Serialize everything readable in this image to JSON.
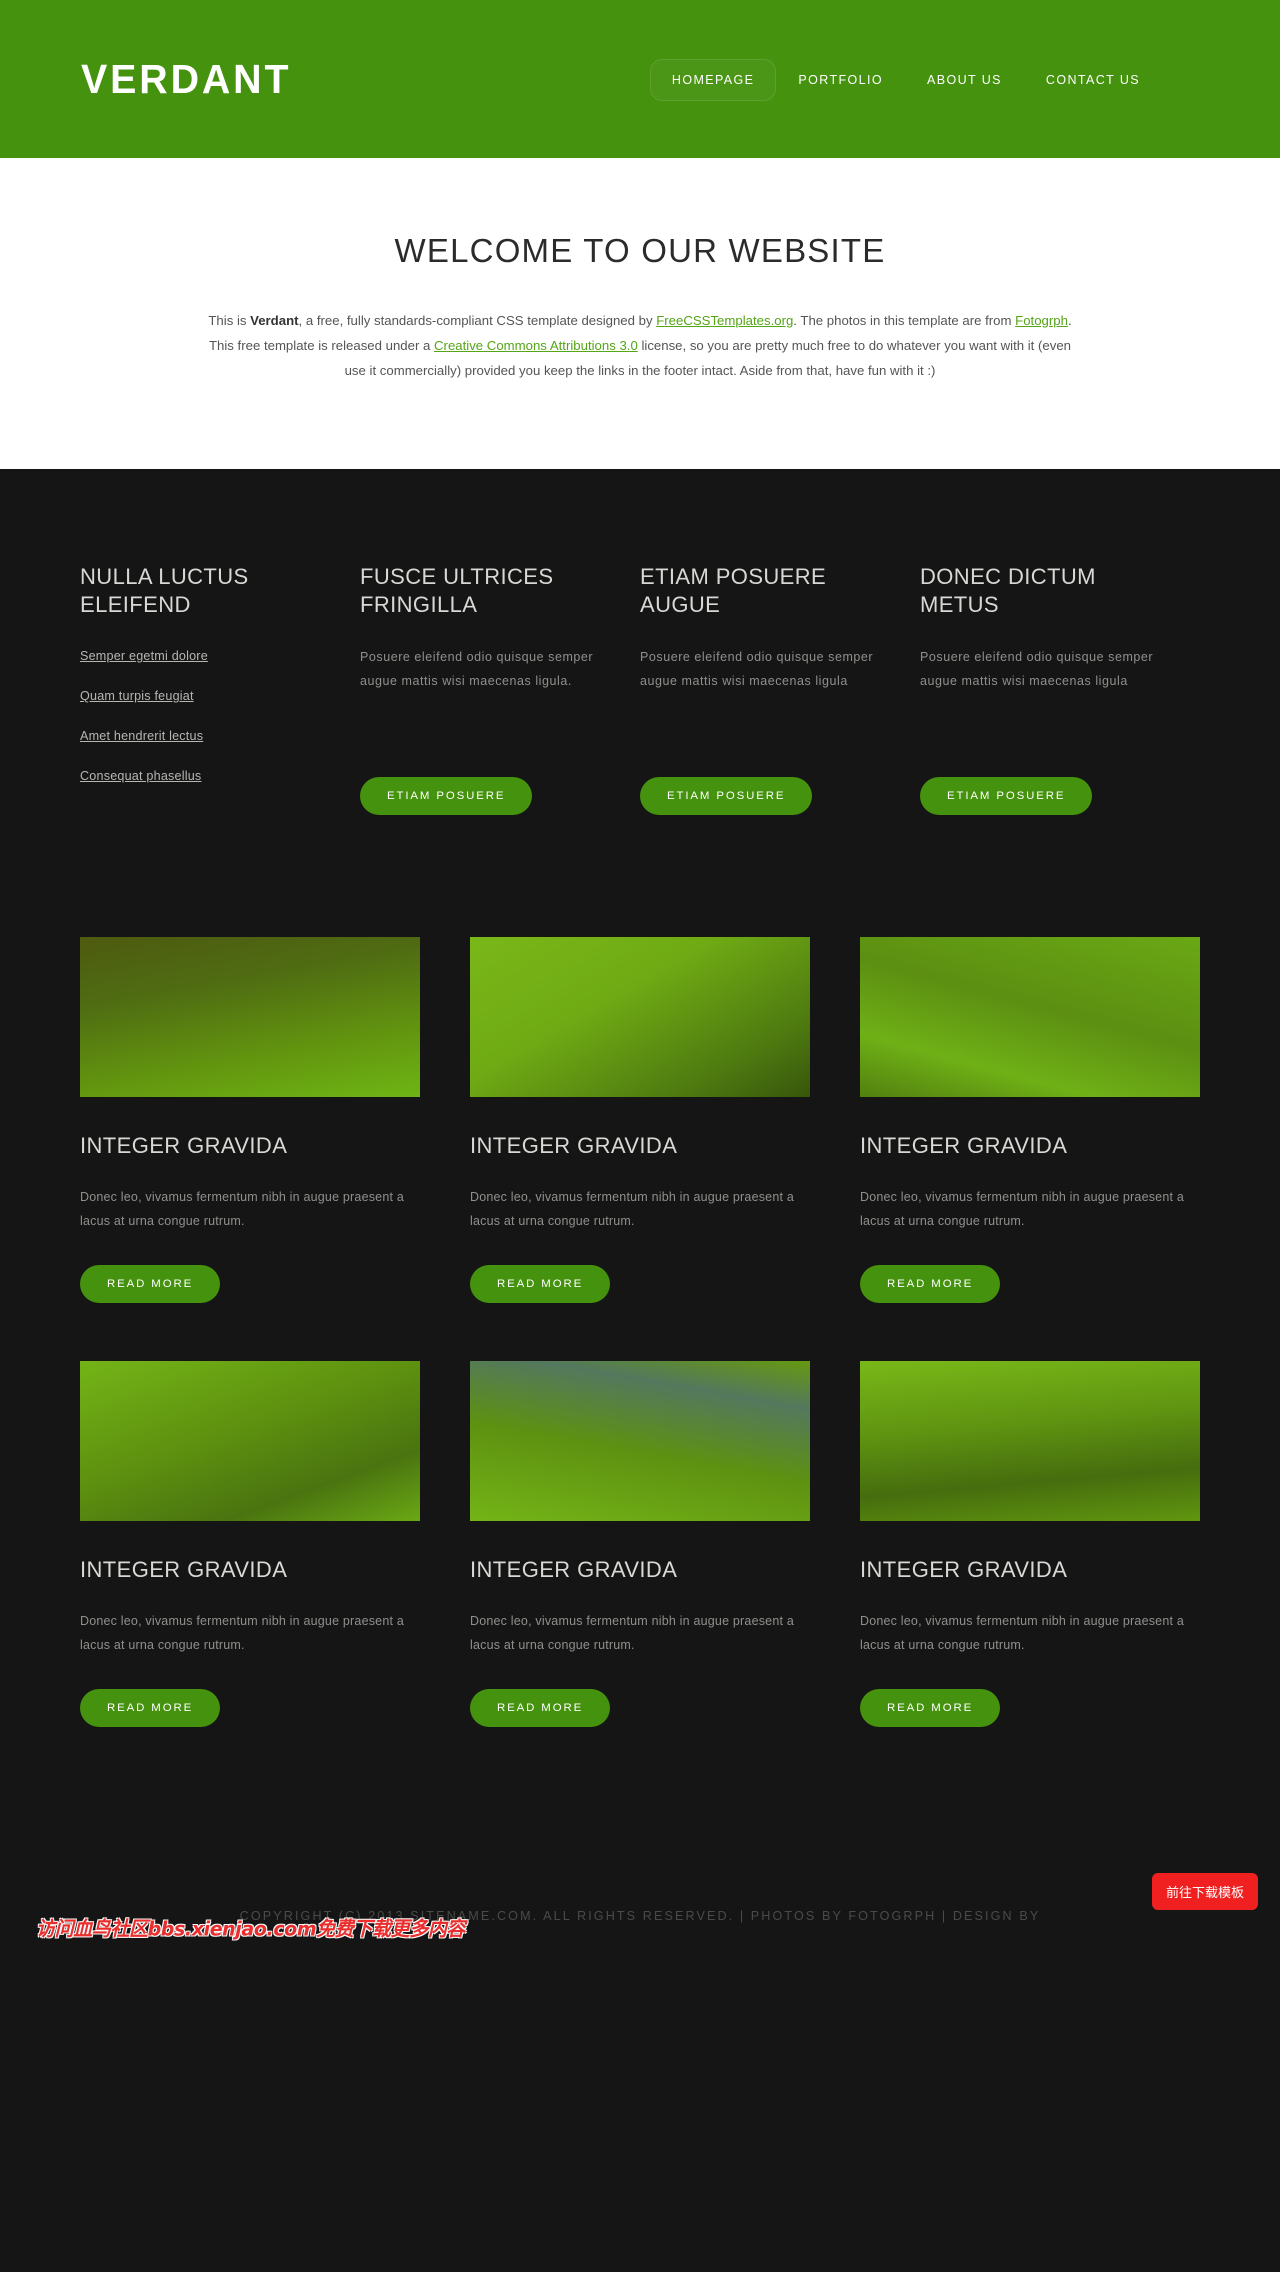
{
  "header": {
    "logo": "VERDANT",
    "nav": [
      {
        "label": "HOMEPAGE",
        "active": true
      },
      {
        "label": "PORTFOLIO",
        "active": false
      },
      {
        "label": "ABOUT US",
        "active": false
      },
      {
        "label": "CONTACT US",
        "active": false
      }
    ]
  },
  "welcome": {
    "title": "WELCOME TO OUR WEBSITE",
    "p1": "This is ",
    "brand": "Verdant",
    "p2": ", a free, fully standards-compliant CSS template designed by ",
    "link1": "FreeCSSTemplates.org",
    "p3": ". The photos in this template are from ",
    "link2": "Fotogrph",
    "p4": ". This free template is released under a ",
    "link3": "Creative Commons Attributions 3.0",
    "p5": " license, so you are pretty much free to do whatever you want with it (even use it commercially) provided you keep the links in the footer intact. Aside from that, have fun with it :)"
  },
  "features": [
    {
      "title": "NULLA LUCTUS ELEIFEND",
      "links": [
        "Semper egetmi dolore",
        "Quam turpis feugiat",
        "Amet hendrerit lectus",
        "Consequat phasellus"
      ]
    },
    {
      "title": "FUSCE ULTRICES FRINGILLA",
      "text": "Posuere eleifend odio quisque semper augue mattis wisi maecenas ligula.",
      "button": "ETIAM POSUERE"
    },
    {
      "title": "ETIAM POSUERE AUGUE",
      "text": "Posuere eleifend odio quisque semper augue mattis wisi maecenas ligula",
      "button": "ETIAM POSUERE"
    },
    {
      "title": "DONEC DICTUM METUS",
      "text": "Posuere eleifend odio quisque semper augue mattis wisi maecenas ligula",
      "button": "ETIAM POSUERE"
    }
  ],
  "gallery": [
    {
      "title": "INTEGER GRAVIDA",
      "text": "Donec leo, vivamus fermentum nibh in augue praesent a lacus at urna congue rutrum.",
      "button": "READ MORE"
    },
    {
      "title": "INTEGER GRAVIDA",
      "text": "Donec leo, vivamus fermentum nibh in augue praesent a lacus at urna congue rutrum.",
      "button": "READ MORE"
    },
    {
      "title": "INTEGER GRAVIDA",
      "text": "Donec leo, vivamus fermentum nibh in augue praesent a lacus at urna congue rutrum.",
      "button": "READ MORE"
    },
    {
      "title": "INTEGER GRAVIDA",
      "text": "Donec leo, vivamus fermentum nibh in augue praesent a lacus at urna congue rutrum.",
      "button": "READ MORE"
    },
    {
      "title": "INTEGER GRAVIDA",
      "text": "Donec leo, vivamus fermentum nibh in augue praesent a lacus at urna congue rutrum.",
      "button": "READ MORE"
    },
    {
      "title": "INTEGER GRAVIDA",
      "text": "Donec leo, vivamus fermentum nibh in augue praesent a lacus at urna congue rutrum.",
      "button": "READ MORE"
    }
  ],
  "footer": {
    "copyright": "COPYRIGHT (C) 2013 SITENAME.COM. ALL RIGHTS RESERVED. | PHOTOS BY FOTOGRPH | DESIGN BY"
  },
  "overlay": {
    "watermark": "访问血鸟社区bbs.xienjao.com免费下载更多内容",
    "download_button": "前往下载模板"
  },
  "colors": {
    "brand_green": "#44920d",
    "link_green": "#55a516",
    "dark_bg": "#151515",
    "watermark_red": "#ea2d2d",
    "download_red": "#f02020"
  }
}
